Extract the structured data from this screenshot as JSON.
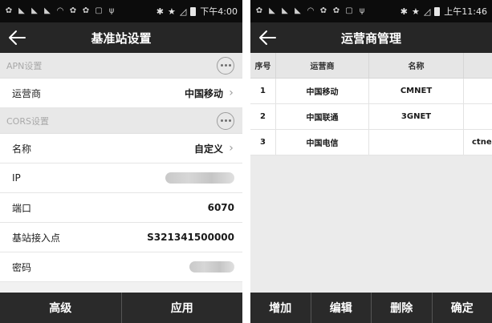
{
  "left": {
    "status": {
      "time": "下午4:00"
    },
    "title": "基准站设置",
    "sections": [
      {
        "label": "APN设置",
        "rows": [
          {
            "label": "运营商",
            "value": "中国移动",
            "chevron": true
          }
        ]
      },
      {
        "label": "CORS设置",
        "rows": [
          {
            "label": "名称",
            "value": "自定义",
            "chevron": true
          },
          {
            "label": "IP",
            "value": "",
            "blurred": true
          },
          {
            "label": "端口",
            "value": "6070"
          },
          {
            "label": "基站接入点",
            "value": "S321341500000"
          },
          {
            "label": "密码",
            "value": "",
            "blurred": true
          }
        ]
      }
    ],
    "buttons": [
      "高级",
      "应用"
    ]
  },
  "right": {
    "status": {
      "time": "上午11:46"
    },
    "title": "运营商管理",
    "table": {
      "headers": [
        "序号",
        "运营商",
        "名称",
        ""
      ],
      "rows": [
        [
          "1",
          "中国移动",
          "CMNET",
          ""
        ],
        [
          "2",
          "中国联通",
          "3GNET",
          ""
        ],
        [
          "3",
          "中国电信",
          "",
          "ctne"
        ]
      ]
    },
    "buttons": [
      "增加",
      "编辑",
      "删除",
      "确定"
    ]
  },
  "icons": {
    "back": "back-arrow-icon",
    "more": "more-options-icon",
    "chevron": "chevron-right-icon"
  },
  "colors": {
    "titlebar": "#262626",
    "statusbar": "#0c0c0c",
    "bottombar": "#2a2a2a",
    "section": "#e8e8e8"
  }
}
